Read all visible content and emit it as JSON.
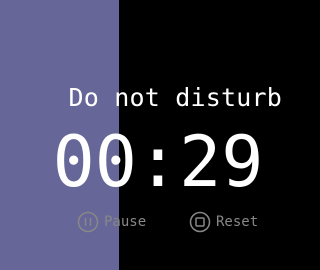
{
  "timer": {
    "label": "Do not disturb",
    "remaining": "00:29",
    "progress_fraction": 0.39
  },
  "controls": {
    "pause_label": "Pause",
    "reset_label": "Reset",
    "pause_icon": "pause-circle-icon",
    "reset_icon": "stop-circle-icon"
  },
  "colors": {
    "background": "#000000",
    "progress": "#666699",
    "text": "#ffffff",
    "muted": "#888888"
  }
}
